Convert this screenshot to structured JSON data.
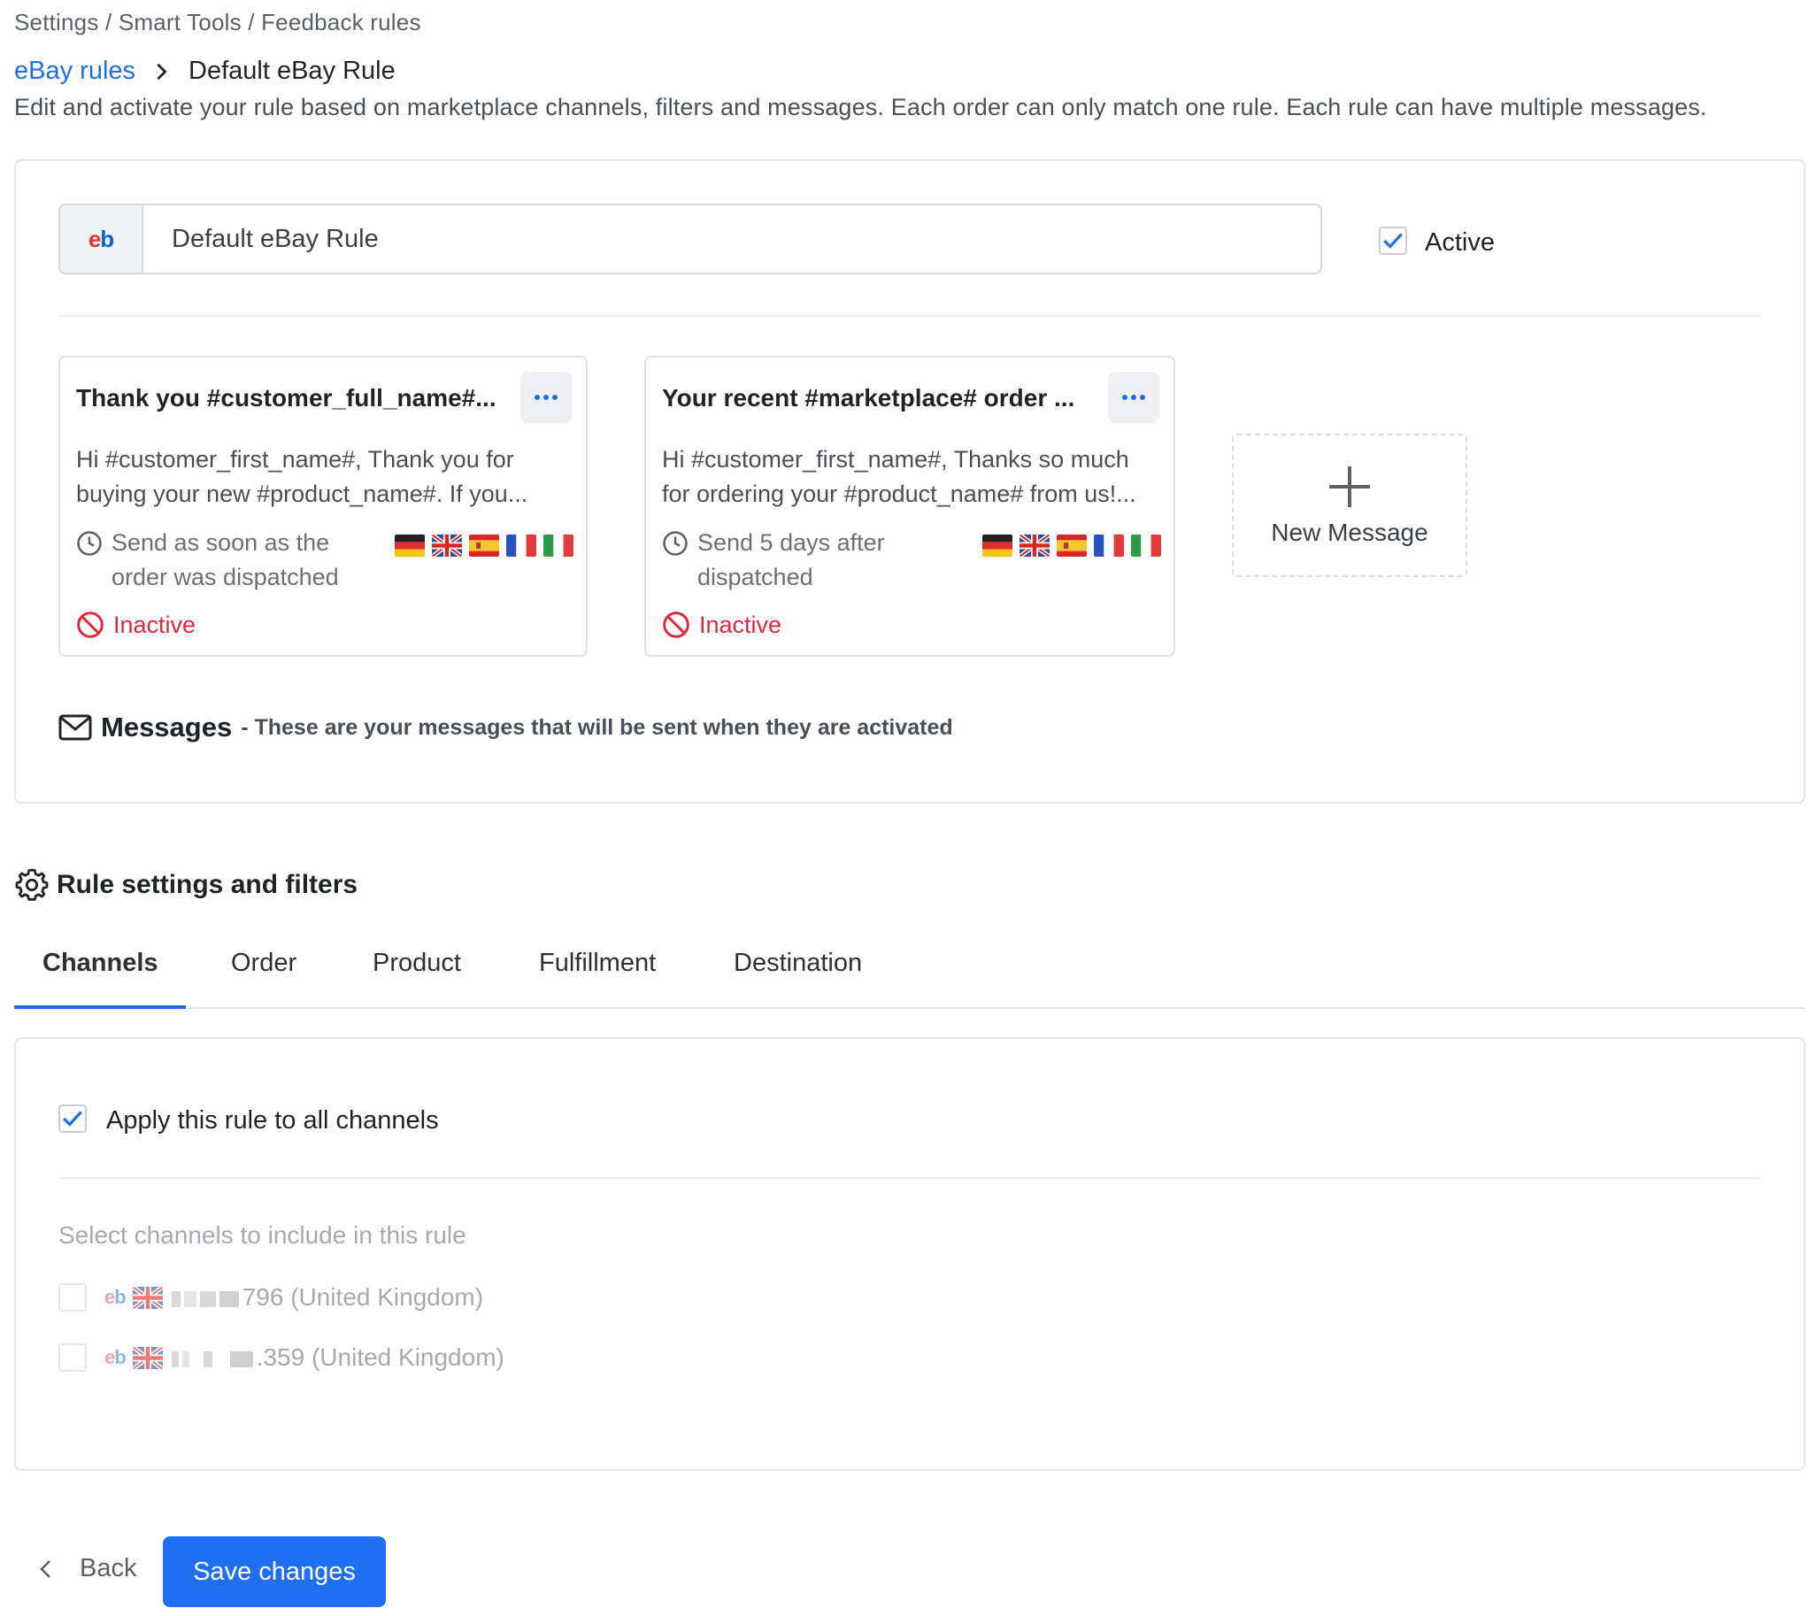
{
  "breadcrumb": "Settings / Smart Tools / Feedback rules",
  "header": {
    "parent_link": "eBay rules",
    "current": "Default eBay Rule",
    "description": "Edit and activate your rule based on marketplace channels, filters and messages. Each order can only match one rule. Each rule can have multiple messages."
  },
  "rule": {
    "name": "Default eBay Rule",
    "marketplace_icon": "ebay-logo-icon",
    "active_label": "Active",
    "active_checked": true
  },
  "messages": [
    {
      "title": "Thank you #customer_full_name#...",
      "body_line1": "Hi #customer_first_name#, Thank you for",
      "body_line2": "buying your new #product_name#. If you...",
      "schedule_line1": "Send as soon as the",
      "schedule_line2": "order was dispatched",
      "status": "Inactive",
      "languages": [
        "de",
        "gb",
        "es",
        "fr",
        "it"
      ]
    },
    {
      "title": "Your recent #marketplace# order ...",
      "body_line1": "Hi #customer_first_name#, Thanks so much",
      "body_line2": "for ordering your #product_name# from us!...",
      "schedule_line1": "Send 5 days after",
      "schedule_line2": "dispatched",
      "status": "Inactive",
      "languages": [
        "de",
        "gb",
        "es",
        "fr",
        "it"
      ]
    }
  ],
  "new_message_label": "New Message",
  "messages_section": {
    "heading": "Messages",
    "subtitle": "- These are your messages that will be sent when they are activated"
  },
  "settings": {
    "heading": "Rule settings and filters",
    "tabs": [
      "Channels",
      "Order",
      "Product",
      "Fulfillment",
      "Destination"
    ],
    "active_tab": "Channels"
  },
  "channels": {
    "apply_all_label": "Apply this rule to all channels",
    "apply_all_checked": true,
    "select_label": "Select channels to include in this rule",
    "items": [
      {
        "suffix": "796 (United Kingdom)"
      },
      {
        "suffix": ".359 (United Kingdom)"
      }
    ]
  },
  "footer": {
    "back_label": "Back",
    "save_label": "Save changes"
  },
  "colors": {
    "accent": "#1f6fe0",
    "inactive": "#e0283a",
    "ebay_red": "#e53238",
    "ebay_blue": "#0064d2"
  }
}
